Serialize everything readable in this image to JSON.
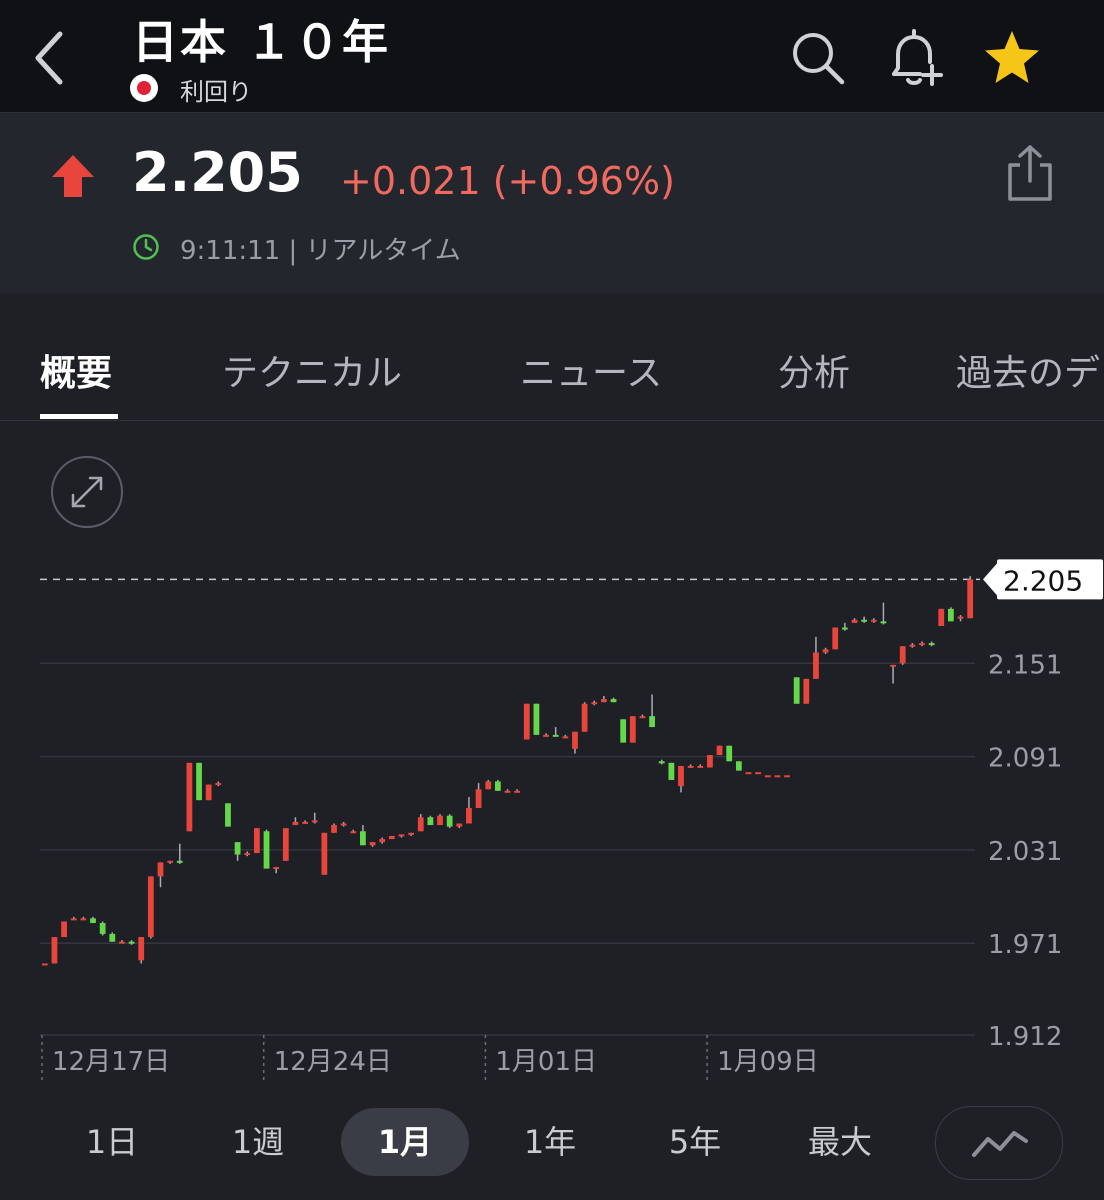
{
  "header": {
    "title": "日本 １０年",
    "subtitle": "利回り",
    "icons": [
      "chevron-left-icon",
      "search-icon",
      "bell-plus-icon",
      "star-icon"
    ]
  },
  "quote": {
    "price": "2.205",
    "change": "+0.021 (+0.96%)",
    "time": "9:11:11 | リアルタイム",
    "colors": {
      "up": "#e8453c",
      "change_text": "#f06a5f",
      "clock": "#4fc24f",
      "star": "#f5c518"
    }
  },
  "tabs": [
    {
      "label": "概要"
    },
    {
      "label": "テクニカル"
    },
    {
      "label": "ニュース"
    },
    {
      "label": "分析"
    },
    {
      "label": "過去のデ"
    }
  ],
  "chart_data": {
    "type": "candlestick",
    "current_price": 2.205,
    "current_label": "2.205",
    "y_ticks": [
      "2.151",
      "2.091",
      "2.031",
      "1.971",
      "1.912"
    ],
    "y_tick_values": [
      2.151,
      2.091,
      2.031,
      1.971,
      1.912
    ],
    "ylim": [
      1.912,
      2.211
    ],
    "x_labels": [
      "12月17日",
      "12月24日",
      "1月01日",
      "1月09日"
    ],
    "x_label_indices": [
      0,
      23,
      46,
      69
    ],
    "colors": {
      "up": "#e8453c",
      "down": "#64d84a"
    },
    "candles": [
      [
        1.958,
        1.958,
        1.957,
        1.957
      ],
      [
        1.958,
        1.975,
        1.975,
        1.958
      ],
      [
        1.975,
        1.985,
        1.985,
        1.975
      ],
      [
        1.986,
        1.987,
        1.988,
        1.986
      ],
      [
        1.987,
        1.987,
        1.988,
        1.986
      ],
      [
        1.987,
        1.984,
        1.988,
        1.984
      ],
      [
        1.984,
        1.977,
        1.985,
        1.976
      ],
      [
        1.977,
        1.972,
        1.978,
        1.972
      ],
      [
        1.972,
        1.972,
        1.973,
        1.971
      ],
      [
        1.972,
        1.971,
        1.973,
        1.97
      ],
      [
        1.96,
        1.975,
        1.975,
        1.958
      ],
      [
        1.975,
        2.014,
        2.014,
        1.974
      ],
      [
        2.014,
        2.023,
        2.023,
        2.007
      ],
      [
        2.023,
        2.024,
        2.024,
        2.022
      ],
      [
        2.024,
        2.023,
        2.035,
        2.022
      ],
      [
        2.043,
        2.087,
        2.087,
        2.043
      ],
      [
        2.087,
        2.063,
        2.087,
        2.063
      ],
      [
        2.063,
        2.073,
        2.073,
        2.063
      ],
      [
        2.073,
        2.074,
        2.075,
        2.072
      ],
      [
        2.061,
        2.046,
        2.061,
        2.046
      ],
      [
        2.036,
        2.028,
        2.036,
        2.024
      ],
      [
        2.028,
        2.029,
        2.03,
        2.027
      ],
      [
        2.029,
        2.045,
        2.045,
        2.029
      ],
      [
        2.043,
        2.019,
        2.044,
        2.019
      ],
      [
        2.019,
        2.02,
        2.02,
        2.016
      ],
      [
        2.024,
        2.045,
        2.045,
        2.024
      ],
      [
        2.047,
        2.049,
        2.052,
        2.047
      ],
      [
        2.049,
        2.049,
        2.05,
        2.048
      ],
      [
        2.05,
        2.05,
        2.055,
        2.048
      ],
      [
        2.015,
        2.042,
        2.042,
        2.015
      ],
      [
        2.042,
        2.047,
        2.048,
        2.042
      ],
      [
        2.047,
        2.048,
        2.049,
        2.046
      ],
      [
        2.043,
        2.043,
        2.044,
        2.042
      ],
      [
        2.043,
        2.034,
        2.047,
        2.034
      ],
      [
        2.034,
        2.036,
        2.036,
        2.033
      ],
      [
        2.036,
        2.038,
        2.039,
        2.035
      ],
      [
        2.038,
        2.04,
        2.04,
        2.038
      ],
      [
        2.04,
        2.041,
        2.041,
        2.039
      ],
      [
        2.041,
        2.042,
        2.042,
        2.04
      ],
      [
        2.043,
        2.052,
        2.054,
        2.043
      ],
      [
        2.052,
        2.047,
        2.053,
        2.047
      ],
      [
        2.047,
        2.053,
        2.054,
        2.047
      ],
      [
        2.053,
        2.046,
        2.054,
        2.045
      ],
      [
        2.046,
        2.048,
        2.048,
        2.045
      ],
      [
        2.048,
        2.058,
        2.065,
        2.048
      ],
      [
        2.058,
        2.07,
        2.074,
        2.058
      ],
      [
        2.07,
        2.075,
        2.076,
        2.07
      ],
      [
        2.075,
        2.069,
        2.076,
        2.069
      ],
      [
        2.069,
        2.069,
        2.07,
        2.068
      ],
      [
        2.069,
        2.069,
        2.07,
        2.068
      ],
      [
        2.102,
        2.125,
        2.125,
        2.102
      ],
      [
        2.125,
        2.105,
        2.125,
        2.105
      ],
      [
        2.105,
        2.105,
        2.106,
        2.104
      ],
      [
        2.105,
        2.104,
        2.11,
        2.104
      ],
      [
        2.104,
        2.104,
        2.105,
        2.103
      ],
      [
        2.096,
        2.107,
        2.107,
        2.093
      ],
      [
        2.107,
        2.125,
        2.126,
        2.107
      ],
      [
        2.125,
        2.126,
        2.127,
        2.124
      ],
      [
        2.126,
        2.128,
        2.13,
        2.126
      ],
      [
        2.128,
        2.126,
        2.129,
        2.126
      ],
      [
        2.115,
        2.1,
        2.115,
        2.1
      ],
      [
        2.1,
        2.117,
        2.117,
        2.1
      ],
      [
        2.117,
        2.117,
        2.118,
        2.116
      ],
      [
        2.117,
        2.11,
        2.131,
        2.11
      ],
      [
        2.088,
        2.087,
        2.089,
        2.086
      ],
      [
        2.087,
        2.076,
        2.087,
        2.076
      ],
      [
        2.072,
        2.085,
        2.085,
        2.068
      ],
      [
        2.085,
        2.085,
        2.086,
        2.084
      ],
      [
        2.085,
        2.085,
        2.086,
        2.084
      ],
      [
        2.084,
        2.092,
        2.092,
        2.084
      ],
      [
        2.092,
        2.098,
        2.098,
        2.092
      ],
      [
        2.098,
        2.088,
        2.098,
        2.088
      ],
      [
        2.088,
        2.082,
        2.088,
        2.082
      ],
      [
        2.081,
        2.081,
        2.081,
        2.081
      ],
      [
        2.081,
        2.081,
        2.081,
        2.081
      ],
      [
        2.079,
        2.079,
        2.079,
        2.079
      ],
      [
        2.079,
        2.079,
        2.079,
        2.079
      ],
      [
        2.079,
        2.079,
        2.079,
        2.079
      ],
      [
        2.142,
        2.125,
        2.142,
        2.125
      ],
      [
        2.125,
        2.141,
        2.141,
        2.125
      ],
      [
        2.141,
        2.158,
        2.168,
        2.141
      ],
      [
        2.158,
        2.16,
        2.161,
        2.157
      ],
      [
        2.16,
        2.174,
        2.174,
        2.16
      ],
      [
        2.174,
        2.173,
        2.177,
        2.172
      ],
      [
        2.177,
        2.179,
        2.18,
        2.177
      ],
      [
        2.179,
        2.178,
        2.181,
        2.177
      ],
      [
        2.178,
        2.179,
        2.18,
        2.177
      ],
      [
        2.178,
        2.177,
        2.19,
        2.176
      ],
      [
        2.15,
        2.15,
        2.15,
        2.138
      ],
      [
        2.151,
        2.162,
        2.162,
        2.15
      ],
      [
        2.162,
        2.163,
        2.164,
        2.161
      ],
      [
        2.163,
        2.164,
        2.165,
        2.162
      ],
      [
        2.164,
        2.163,
        2.165,
        2.162
      ],
      [
        2.175,
        2.186,
        2.186,
        2.175
      ],
      [
        2.186,
        2.178,
        2.187,
        2.178
      ],
      [
        2.181,
        2.181,
        2.182,
        2.178
      ],
      [
        2.18,
        2.205,
        2.207,
        2.18
      ]
    ]
  },
  "periods": [
    {
      "label": "1日"
    },
    {
      "label": "1週"
    },
    {
      "label": "1月",
      "active": true
    },
    {
      "label": "1年"
    },
    {
      "label": "5年"
    },
    {
      "label": "最大"
    }
  ]
}
